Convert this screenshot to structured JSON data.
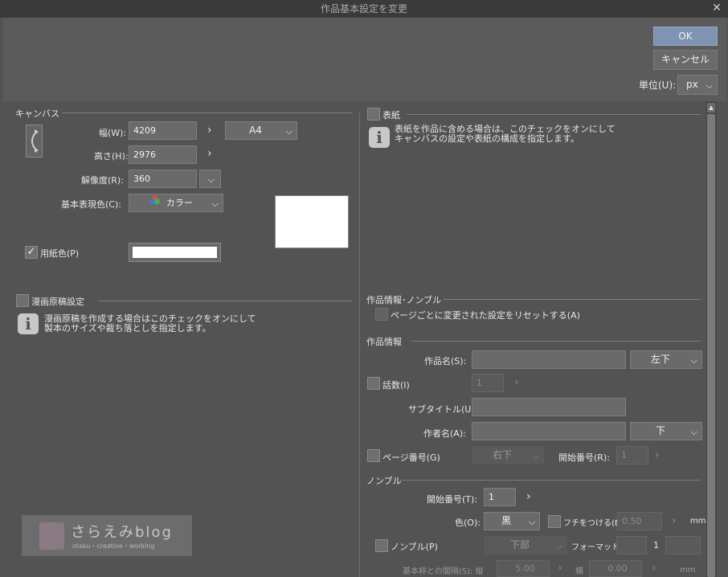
{
  "window": {
    "title": "作品基本設定を変更",
    "close_symbol": "✕"
  },
  "buttons": {
    "ok": "OK",
    "cancel": "キャンセル"
  },
  "unit": {
    "label": "単位(U):",
    "value": "px"
  },
  "canvas": {
    "section_title": "キャンバス",
    "width_label": "幅(W):",
    "width_value": "4209",
    "height_label": "高さ(H):",
    "height_value": "2976",
    "resolution_label": "解像度(R):",
    "resolution_value": "360",
    "size_preset": "A4",
    "color_mode_label": "基本表現色(C):",
    "color_mode_value": "カラー",
    "paper_color_label": "用紙色(P)",
    "paper_color_checked": true
  },
  "manga": {
    "section_title": "漫画原稿設定",
    "info_line1": "漫画原稿を作成する場合はこのチェックをオンにして",
    "info_line2": "製本のサイズや裁ち落としを指定します。"
  },
  "cover": {
    "section_title": "表紙",
    "info_line1": "表紙を作品に含める場合は、このチェックをオンにして",
    "info_line2": "キャンバスの設定や表紙の構成を指定します。"
  },
  "work_info_nombre": {
    "section_title": "作品情報･ノンブル",
    "reset_label": "ページごとに変更された設定をリセットする(A)"
  },
  "work_info": {
    "section_title": "作品情報",
    "title_label": "作品名(S):",
    "title_value": "",
    "title_pos": "左下",
    "episode_label": "話数(I)",
    "episode_value": "1",
    "subtitle_label": "サブタイトル(U):",
    "subtitle_value": "",
    "author_label": "作者名(A):",
    "author_value": "",
    "author_pos": "下",
    "page_number_label": "ページ番号(G)",
    "page_number_pos": "右下",
    "start_number_label": "開始番号(R):",
    "start_number_value": "1"
  },
  "nombre": {
    "section_title": "ノンブル",
    "start_label": "開始番号(T):",
    "start_value": "1",
    "color_label": "色(O):",
    "color_value": "黒",
    "edge_label": "フチをつける(E)",
    "edge_value": "0.50",
    "edge_unit": "mm",
    "nombre_label": "ノンブル(P)",
    "nombre_pos": "下部",
    "format_label": "フォーマット:",
    "format_value": "1",
    "spacing_label": "基本枠との間隔(S): 縦",
    "spacing_v_value": "5.00",
    "spacing_h_label": "横",
    "spacing_h_value": "0.00",
    "spacing_unit": "mm"
  },
  "watermark": {
    "title": "さらえみblog",
    "subtitle": "otaku・creative・working"
  },
  "icons": {
    "rotate": "rotate-orientation-icon",
    "color_wheel": "color-wheel-icon"
  }
}
